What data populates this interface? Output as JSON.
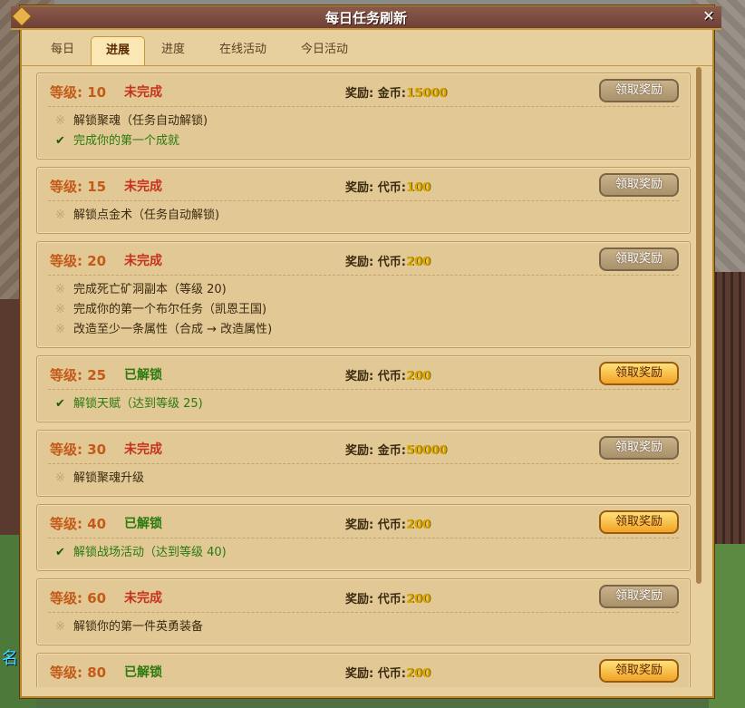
{
  "background": {
    "side_label": "名"
  },
  "window": {
    "title": "每日任务刷新",
    "close_glyph": "✕"
  },
  "tabs": [
    {
      "label": "每日"
    },
    {
      "label": "进展",
      "active": true
    },
    {
      "label": "进度"
    },
    {
      "label": "在线活动"
    },
    {
      "label": "今日活动"
    }
  ],
  "reward_prefix": "奖励: ",
  "colors": {
    "accent": "#c45a18",
    "pending": "#c7321c",
    "done": "#2a7a10",
    "amount": "#d9a800"
  },
  "tasks": [
    {
      "level": "等级: 10",
      "status": "未完成",
      "state": "pending",
      "reward_type": "金币:",
      "amount": "15000",
      "button": "领取奖励",
      "button_enabled": false,
      "items": [
        {
          "text": "解锁聚魂（任务自动解锁)",
          "done": false
        },
        {
          "text": "完成你的第一个成就",
          "done": true
        }
      ]
    },
    {
      "level": "等级: 15",
      "status": "未完成",
      "state": "pending",
      "reward_type": "代币:",
      "amount": "100",
      "button": "领取奖励",
      "button_enabled": false,
      "items": [
        {
          "text": "解锁点金术（任务自动解锁)",
          "done": false
        }
      ]
    },
    {
      "level": "等级: 20",
      "status": "未完成",
      "state": "pending",
      "reward_type": "代币:",
      "amount": "200",
      "button": "领取奖励",
      "button_enabled": false,
      "items": [
        {
          "text": "完成死亡矿洞副本（等级 20)",
          "done": false
        },
        {
          "text": "完成你的第一个布尔任务（凯恩王国)",
          "done": false
        },
        {
          "text": "改造至少一条属性（合成 → 改造属性)",
          "done": false
        }
      ]
    },
    {
      "level": "等级: 25",
      "status": "已解锁",
      "state": "done",
      "reward_type": "代币:",
      "amount": "200",
      "button": "领取奖励",
      "button_enabled": true,
      "items": [
        {
          "text": "解锁天赋（达到等级 25)",
          "done": true
        }
      ]
    },
    {
      "level": "等级: 30",
      "status": "未完成",
      "state": "pending",
      "reward_type": "金币:",
      "amount": "50000",
      "button": "领取奖励",
      "button_enabled": false,
      "items": [
        {
          "text": "解锁聚魂升级",
          "done": false
        }
      ]
    },
    {
      "level": "等级: 40",
      "status": "已解锁",
      "state": "done",
      "reward_type": "代币:",
      "amount": "200",
      "button": "领取奖励",
      "button_enabled": true,
      "items": [
        {
          "text": "解锁战场活动（达到等级 40)",
          "done": true
        }
      ]
    },
    {
      "level": "等级: 60",
      "status": "未完成",
      "state": "pending",
      "reward_type": "代币:",
      "amount": "200",
      "button": "领取奖励",
      "button_enabled": false,
      "items": [
        {
          "text": "解锁你的第一件英勇装备",
          "done": false
        }
      ]
    },
    {
      "level": "等级: 80",
      "status": "已解锁",
      "state": "done",
      "reward_type": "代币:",
      "amount": "200",
      "button": "领取奖励",
      "button_enabled": true,
      "items": []
    }
  ],
  "marks": {
    "todo": "※",
    "done": "✔"
  }
}
